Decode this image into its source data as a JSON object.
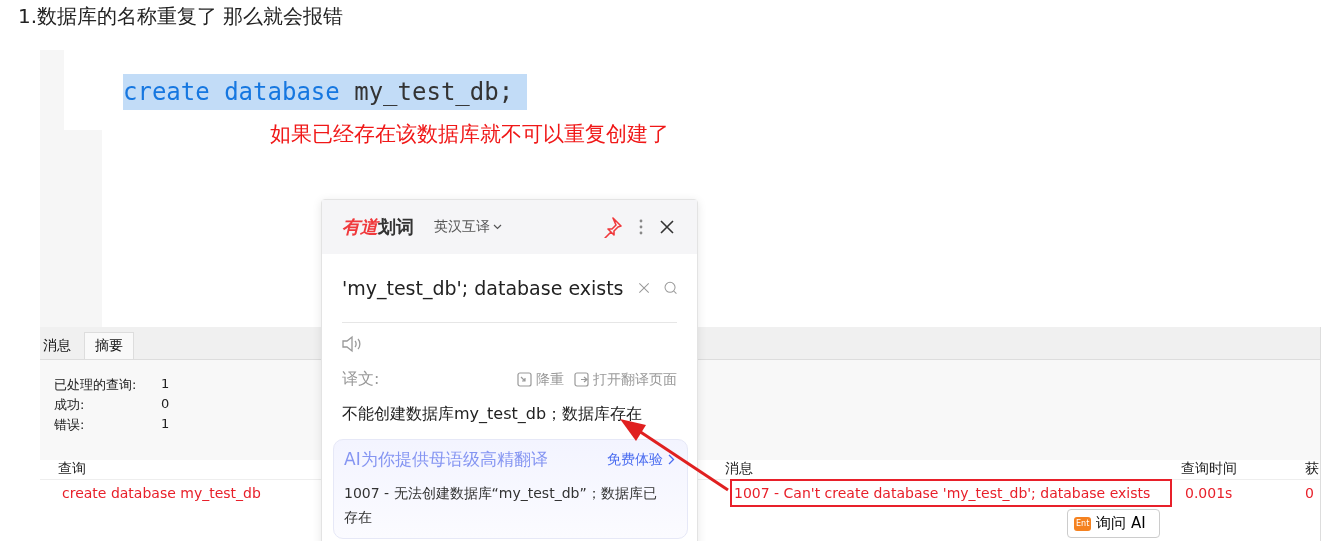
{
  "article": {
    "heading": "1.数据库的名称重复了 那么就会报错",
    "code": {
      "keyword": "create database",
      "name": "my_test_db;",
      "highlighted": true
    },
    "annotation": "如果已经存在该数据库就不可以重复创建了"
  },
  "result_panel": {
    "tabs": [
      {
        "label": "消息",
        "selected": false
      },
      {
        "label": "摘要",
        "selected": true
      }
    ],
    "summary": [
      {
        "label": "已处理的查询:",
        "value": "1"
      },
      {
        "label": "成功:",
        "value": "0"
      },
      {
        "label": "错误:",
        "value": "1"
      }
    ],
    "table": {
      "columns": [
        "查询",
        "消息",
        "查询时间",
        "获"
      ],
      "rows": [
        {
          "cells": [
            "create database my_test_db",
            "1007 - Can't create database 'my_test_db'; database exists",
            "0.001s",
            "0"
          ],
          "error": true
        }
      ]
    },
    "ask_ai_button": {
      "badge": "Ent",
      "label": "询问 AI"
    }
  },
  "popup": {
    "brand": "有道",
    "brand_suffix": "划词",
    "mode": "英汉互译",
    "pinned": true,
    "query": "'my_test_db'; database exists",
    "translation_label": "译文:",
    "actions": [
      "降重",
      "打开翻译页面"
    ],
    "translation": "不能创建数据库my_test_db；数据库存在",
    "ai_banner": {
      "title": "AI为你提供母语级高精翻译",
      "link": "免费体验",
      "text": "1007 - 无法创建数据库“my_test_db”；数据库已存在"
    }
  }
}
